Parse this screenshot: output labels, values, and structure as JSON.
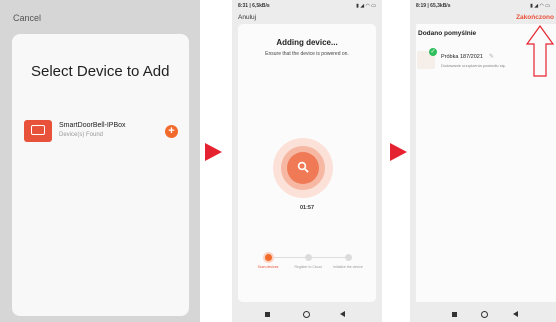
{
  "screen1": {
    "cancel_label": "Cancel",
    "title": "Select Device to Add",
    "device": {
      "name": "SmartDoorBell-IPBox",
      "subtitle": "Device(s) Found",
      "add_symbol": "+"
    },
    "accent_color": "#f26b2c"
  },
  "screen2": {
    "status_left": "8:31 | 6,5kB/s",
    "status_right": "▮ ◢ ◠ ▭",
    "cancel_label": "Anuluj",
    "title": "Adding device...",
    "subtitle": "Ensure that the device is powered on.",
    "timer": "01:57",
    "steps": [
      {
        "label": "Scan devices",
        "state": "active"
      },
      {
        "label": "Register to Cloud",
        "state": "pending"
      },
      {
        "label": "Initialize the device",
        "state": "pending"
      }
    ]
  },
  "screen3": {
    "status_left": "8:19 | 65,3kB/s",
    "status_right": "▮ ◢ ◠ ▭",
    "done_label": "Zakończono",
    "section_title": "Dodano pomyślnie",
    "device_name": "Próbka 187/2021",
    "device_message": "Dodawanie urządzenia powiodło się.",
    "success_color": "#2fbf5c"
  },
  "arrow_color": "#e52330"
}
